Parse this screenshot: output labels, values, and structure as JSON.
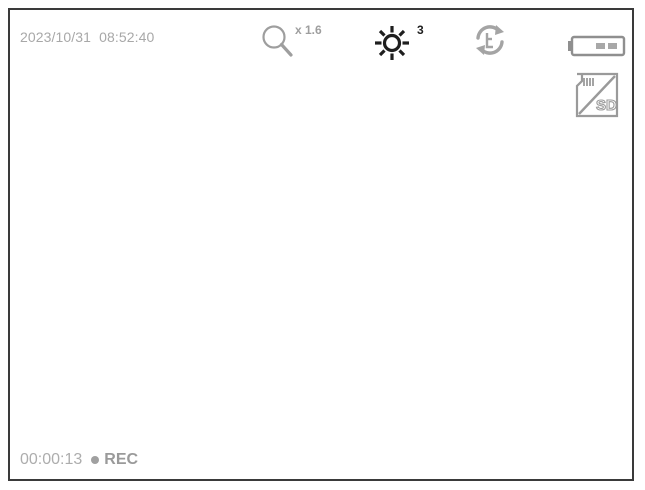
{
  "status_bar": {
    "date": "2023/10/31",
    "time": "08:52:40",
    "zoom_icon": "magnifier-icon",
    "zoom_level": "x 1.6",
    "brightness_icon": "sun-icon",
    "brightness_level": "3",
    "rotate_icon": "rotate-icon",
    "battery_icon": "battery-icon",
    "sd_card_icon": "sd-card-icon",
    "sd_card_label": "SD"
  },
  "recording": {
    "elapsed": "00:00:13",
    "label": "REC",
    "indicator_icon": "record-dot-icon"
  },
  "colors": {
    "border": "#3a3a3a",
    "muted_text": "#a8a8a8",
    "sun_icon": "#1e1e1e",
    "icon_gray": "#9e9e9e"
  }
}
